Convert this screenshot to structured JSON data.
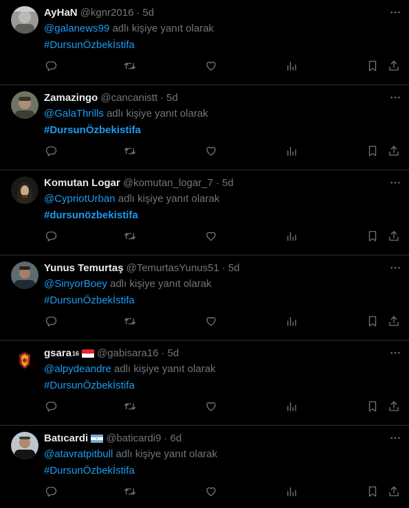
{
  "feed": {
    "reply_suffix": "adlı kişiye yanıt olarak",
    "tweets": [
      {
        "name": "AyHaN",
        "handle": "@kgnr2016",
        "time": "5d",
        "reply_to": "@galanews99",
        "hashtag": "#DursunÖzbekİstifa"
      },
      {
        "name": "Zamazingo",
        "handle": "@cancanistt",
        "time": "5d",
        "reply_to": "@GalaThrills",
        "hashtag": "#DursunÖzbekistifa"
      },
      {
        "name": "Komutan Logar",
        "handle": "@komutan_logar_7",
        "time": "5d",
        "reply_to": "@CypriotUrban",
        "hashtag": "#dursunözbekistifa"
      },
      {
        "name": "Yunus Temurtaş",
        "handle": "@TemurtasYunus51",
        "time": "5d",
        "reply_to": "@SinyorBoey",
        "hashtag": "#DursunÖzbekİstifa"
      },
      {
        "name": "gsara",
        "name_sup": "16",
        "handle": "@gabisara16",
        "time": "5d",
        "reply_to": "@alpydeandre",
        "hashtag": "#DursunÖzbekİstifa"
      },
      {
        "name": "Batıcardi",
        "handle": "@baticardi9",
        "time": "6d",
        "reply_to": "@atavratpitbull",
        "hashtag": "#DursunÖzbekİstifa"
      }
    ]
  },
  "icons": {
    "more": "more-dots-icon",
    "reply": "reply-icon",
    "retweet": "retweet-icon",
    "like": "like-icon",
    "views": "views-icon",
    "bookmark": "bookmark-icon",
    "share": "share-icon"
  },
  "colors": {
    "background": "#000000",
    "text": "#e7e9ea",
    "secondary": "#71767b",
    "link": "#1d9bf0",
    "divider": "#2f3336"
  }
}
